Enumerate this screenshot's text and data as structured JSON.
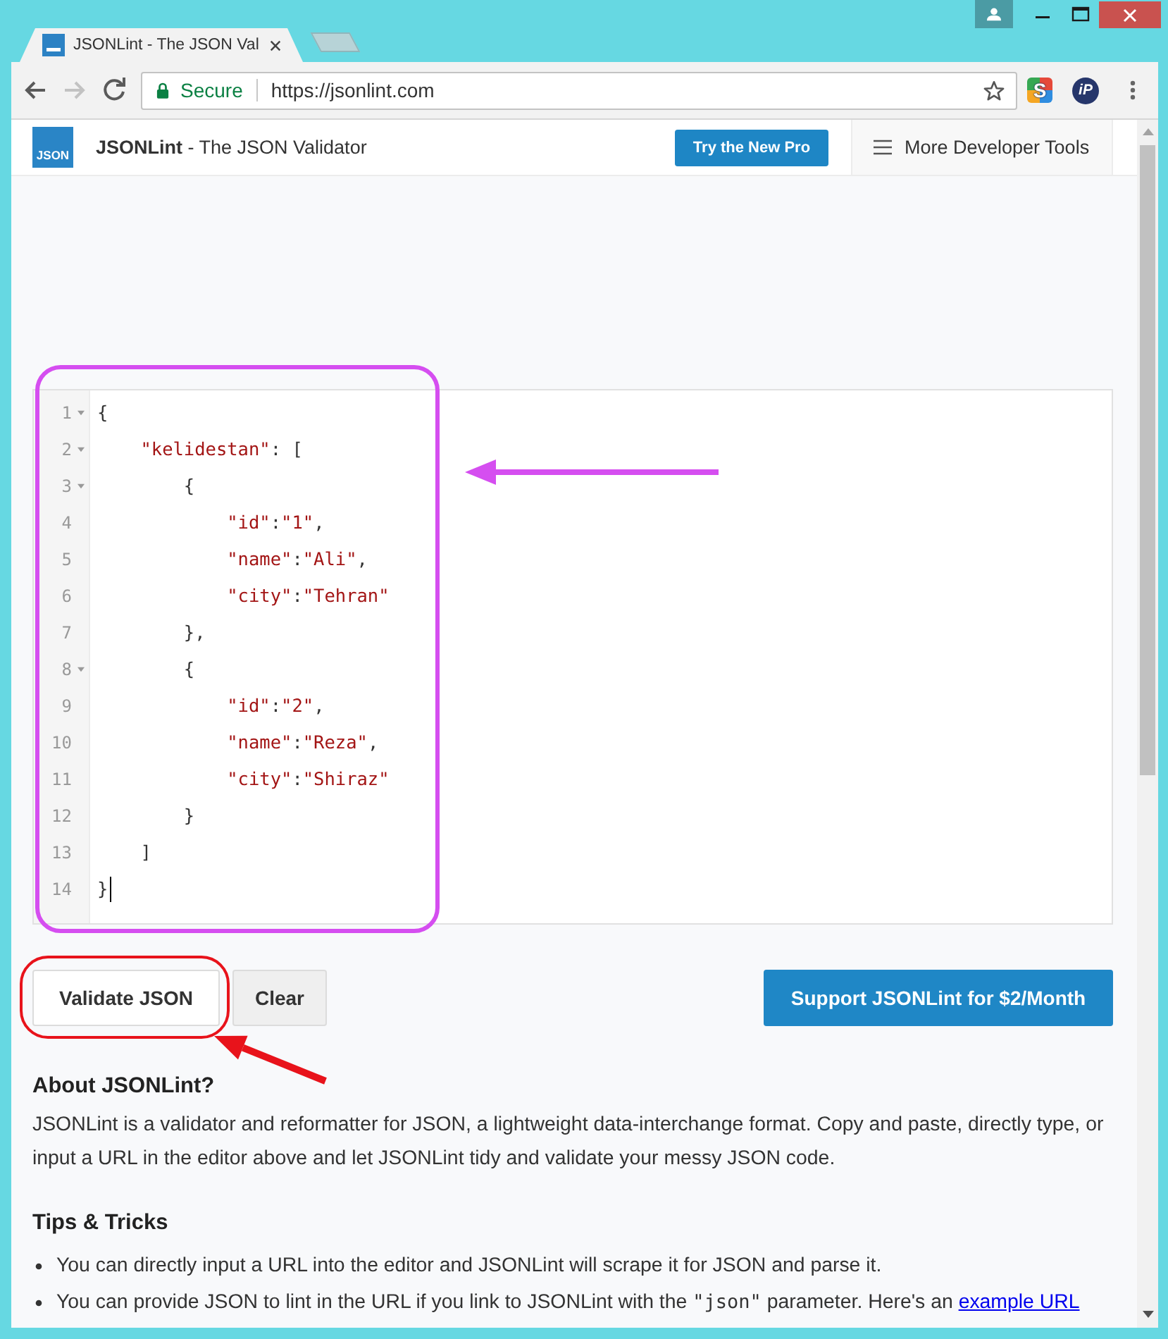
{
  "tabs": [
    {
      "title": "JSONLint - The JSON Val",
      "selected": true
    }
  ],
  "toolbar": {
    "nav": [
      {
        "kind": "back",
        "disabled": false
      },
      {
        "kind": "forward",
        "disabled": true
      },
      {
        "kind": "reload",
        "disabled": false
      }
    ],
    "address_bar": {
      "security": "Secure",
      "url": "https://jsonlint.com",
      "bookmarked": false
    },
    "extensions": [
      {
        "kind": "tile",
        "label": "S"
      },
      {
        "kind": "round",
        "label": "iP"
      }
    ]
  },
  "site_header": {
    "logo": "JSON",
    "title": "**JSONLint** - The JSON Validator",
    "pro_button": "Try the New Pro",
    "tools_menu": "More Developer Tools"
  },
  "editor": {
    "lines": [
      {
        "number": "1",
        "foldable": true,
        "cursor": false,
        "text": "{"
      },
      {
        "number": "2",
        "foldable": true,
        "cursor": false,
        "text": "    \"kelidestan\": ["
      },
      {
        "number": "3",
        "foldable": true,
        "cursor": false,
        "text": "        {"
      },
      {
        "number": "4",
        "foldable": false,
        "cursor": false,
        "text": "            \"id\":\"1\","
      },
      {
        "number": "5",
        "foldable": false,
        "cursor": false,
        "text": "            \"name\":\"Ali\","
      },
      {
        "number": "6",
        "foldable": false,
        "cursor": false,
        "text": "            \"city\":\"Tehran\""
      },
      {
        "number": "7",
        "foldable": false,
        "cursor": false,
        "text": "        },"
      },
      {
        "number": "8",
        "foldable": true,
        "cursor": false,
        "text": "        {"
      },
      {
        "number": "9",
        "foldable": false,
        "cursor": false,
        "text": "            \"id\":\"2\","
      },
      {
        "number": "10",
        "foldable": false,
        "cursor": false,
        "text": "            \"name\":\"Reza\","
      },
      {
        "number": "11",
        "foldable": false,
        "cursor": false,
        "text": "            \"city\":\"Shiraz\""
      },
      {
        "number": "12",
        "foldable": false,
        "cursor": false,
        "text": "        }"
      },
      {
        "number": "13",
        "foldable": false,
        "cursor": false,
        "text": "    ]"
      },
      {
        "number": "14",
        "foldable": false,
        "cursor": true,
        "text": "}"
      }
    ]
  },
  "buttons": [
    {
      "kind": "default",
      "label": "Validate JSON"
    },
    {
      "kind": "secondary",
      "label": "Clear"
    },
    {
      "kind": "primary",
      "label": "Support JSONLint for $2/Month"
    }
  ],
  "about": {
    "heading": "About JSONLint?",
    "text": "JSONLint is a validator and reformatter for JSON, a lightweight data-interchange format. Copy and paste, directly type, or input a URL in the editor above and let JSONLint tidy and validate your messy JSON code."
  },
  "tips": {
    "heading": "Tips & Tricks",
    "items": [
      {
        "parts": [
          {
            "kind": "text",
            "text": "You can directly input a URL into the editor and JSONLint will scrape it for JSON and parse it."
          }
        ]
      },
      {
        "parts": [
          {
            "kind": "text",
            "text": "You can provide JSON to lint in the URL if you link to JSONLint with the "
          },
          {
            "kind": "code",
            "text": "\"json\""
          },
          {
            "kind": "text",
            "text": " parameter. Here's an "
          },
          {
            "kind": "link",
            "text": "example URL"
          }
        ]
      }
    ]
  },
  "annotations": [
    {
      "kind": "frame",
      "color": "#d54ef0"
    },
    {
      "kind": "arrow",
      "color": "#d54ef0"
    },
    {
      "kind": "frame",
      "color": "#e8131b"
    },
    {
      "kind": "arrow",
      "color": "#e8131b"
    }
  ]
}
